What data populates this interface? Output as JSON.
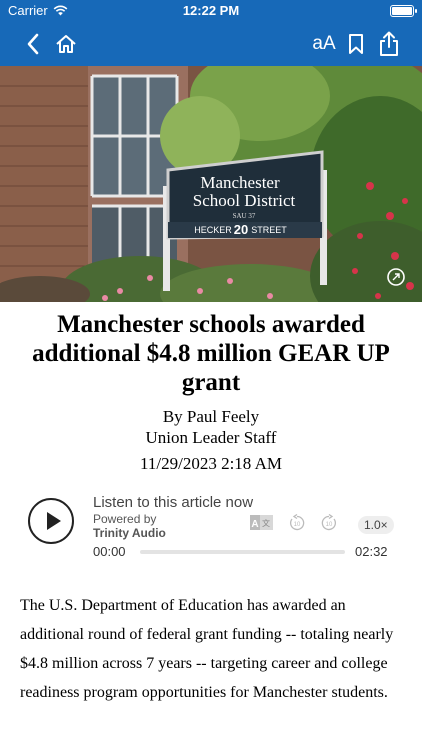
{
  "status_bar": {
    "carrier": "Carrier",
    "time": "12:22 PM"
  },
  "nav_bar": {
    "back_icon": "chevron-left-icon",
    "home_icon": "home-icon",
    "text_size_label": "aA",
    "bookmark_icon": "bookmark-icon",
    "share_icon": "share-icon",
    "background_color": "#1769b8"
  },
  "hero": {
    "sign_line1": "Manchester",
    "sign_line2": "School District",
    "sign_sau": "SAU 37",
    "sign_street_prefix": "HECKER",
    "sign_street_number": "20",
    "sign_street_suffix": "STREET",
    "expand_icon": "expand-icon"
  },
  "article": {
    "headline": "Manchester schools awarded additional $4.8 million GEAR UP grant",
    "byline_author": "By Paul Feely",
    "byline_org": "Union Leader Staff",
    "date": "11/29/2023 2:18 AM",
    "body": "The U.S. Department of Education has awarded an additional round of federal grant funding -- totaling nearly $4.8 million across 7 years -- targeting career and college readiness program opportunities for Manchester students."
  },
  "audio_player": {
    "listen_label": "Listen to this article now",
    "powered_by_label": "Powered by",
    "provider": "Trinity Audio",
    "current_time": "00:00",
    "duration": "02:32",
    "speed": "1.0×",
    "progress": 0
  }
}
